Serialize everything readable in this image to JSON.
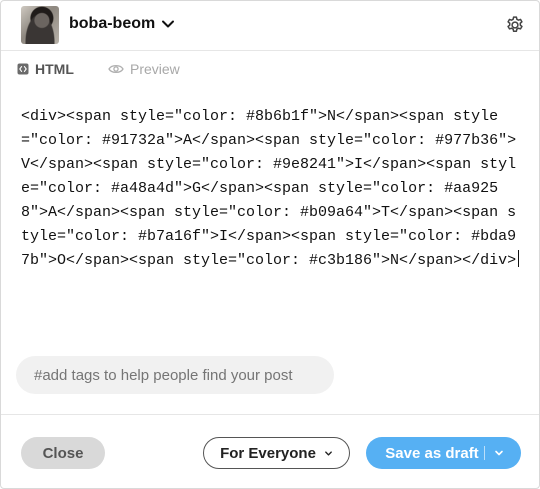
{
  "header": {
    "blog_name": "boba-beom"
  },
  "tabs": [
    {
      "label": "HTML",
      "active": true
    },
    {
      "label": "Preview",
      "active": false
    }
  ],
  "editor": {
    "code": "<div><span style=\"color: #8b6b1f\">N</span><span style=\"color: #91732a\">A</span><span style=\"color: #977b36\">V</span><span style=\"color: #9e8241\">I</span><span style=\"color: #a48a4d\">G</span><span style=\"color: #aa9258\">A</span><span style=\"color: #b09a64\">T</span><span style=\"color: #b7a16f\">I</span><span style=\"color: #bda97b\">O</span><span style=\"color: #c3b186\">N</span></div>"
  },
  "tags": {
    "placeholder": "#add tags to help people find your post"
  },
  "footer": {
    "close_label": "Close",
    "audience_label": "For Everyone",
    "save_label": "Save as draft"
  },
  "colors": {
    "accent": "#56b0f3",
    "close_bg": "#d9d9d9",
    "tags_bg": "#f1f1f1"
  },
  "icons": {
    "settings": "gear-icon",
    "blog_switch": "chevron-down-icon",
    "html_tab": "code-icon",
    "preview_tab": "eye-icon"
  }
}
